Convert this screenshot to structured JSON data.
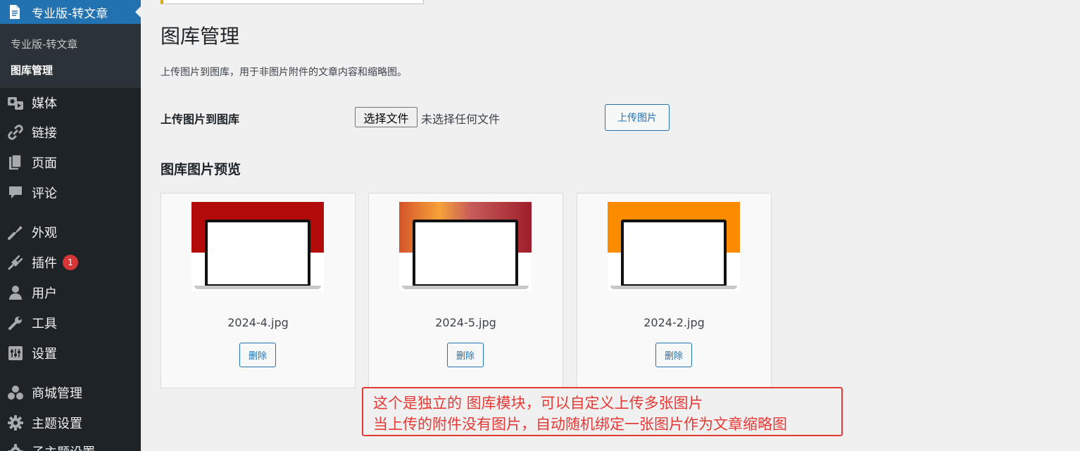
{
  "sidebar": {
    "current_menu": {
      "label": "专业版-转文章",
      "icon": "document-icon"
    },
    "submenu": [
      {
        "label": "专业版-转文章",
        "current": false
      },
      {
        "label": "图库管理",
        "current": true
      }
    ],
    "items": [
      {
        "label": "媒体",
        "icon": "media-icon"
      },
      {
        "label": "链接",
        "icon": "link-icon"
      },
      {
        "label": "页面",
        "icon": "pages-icon"
      },
      {
        "label": "评论",
        "icon": "comment-icon"
      },
      {
        "label": "外观",
        "icon": "appearance-icon"
      },
      {
        "label": "插件",
        "icon": "plugin-icon",
        "badge": "1"
      },
      {
        "label": "用户",
        "icon": "user-icon"
      },
      {
        "label": "工具",
        "icon": "wrench-icon"
      },
      {
        "label": "设置",
        "icon": "settings-icon"
      },
      {
        "label": "商城管理",
        "icon": "group-icon"
      },
      {
        "label": "主题设置",
        "icon": "gear-icon"
      },
      {
        "label": "子主题设置",
        "icon": "gear-icon"
      }
    ]
  },
  "main": {
    "title": "图库管理",
    "description": "上传图片到图库，用于非图片附件的文章内容和缩略图。",
    "upload": {
      "label": "上传图片到图库",
      "file_button": "选择文件",
      "file_status": "未选择任何文件",
      "upload_button": "上传图片"
    },
    "preview_title": "图库图片预览",
    "images": [
      {
        "filename": "2024-4.jpg",
        "delete_label": "删除",
        "color_top": "#b30a0a",
        "color_accent": "#c81010"
      },
      {
        "filename": "2024-5.jpg",
        "delete_label": "删除",
        "color_top": "#c44a2c",
        "color_accent": "#f0a03a"
      },
      {
        "filename": "2024-2.jpg",
        "delete_label": "删除",
        "color_top": "#fb8c00",
        "color_accent": "#ff9800"
      }
    ]
  },
  "annotation": {
    "line1": "这个是独立的 图库模块，可以自定义上传多张图片",
    "line2": "当上传的附件没有图片，自动随机绑定一张图片作为文章缩略图"
  },
  "colors": {
    "sidebar_bg": "#1d2327",
    "current_menu_bg": "#2271b1",
    "accent": "#2271b1",
    "badge": "#d63638",
    "annotation": "#e53935"
  }
}
